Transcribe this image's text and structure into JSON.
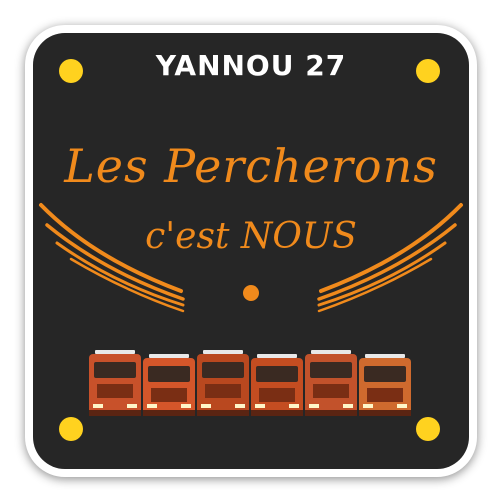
{
  "plate": {
    "title": "YANNOU 27",
    "slogan_line1": "Les Percherons",
    "slogan_line2": "c'est NOUS"
  },
  "colors": {
    "background": "#262626",
    "accent_orange": "#f08a1c",
    "corner_dot_yellow": "#ffd21f",
    "title_white": "#ffffff",
    "truck_orange": "#c9501e"
  },
  "trucks": [
    {
      "icon": "truck-icon",
      "cab_color": "#c8512a"
    },
    {
      "icon": "truck-icon",
      "cab_color": "#d4562a"
    },
    {
      "icon": "truck-icon",
      "cab_color": "#b9481f"
    },
    {
      "icon": "truck-icon",
      "cab_color": "#c44d21"
    },
    {
      "icon": "truck-icon",
      "cab_color": "#c2522b"
    },
    {
      "icon": "truck-icon",
      "cab_color": "#cf6a2e"
    }
  ]
}
